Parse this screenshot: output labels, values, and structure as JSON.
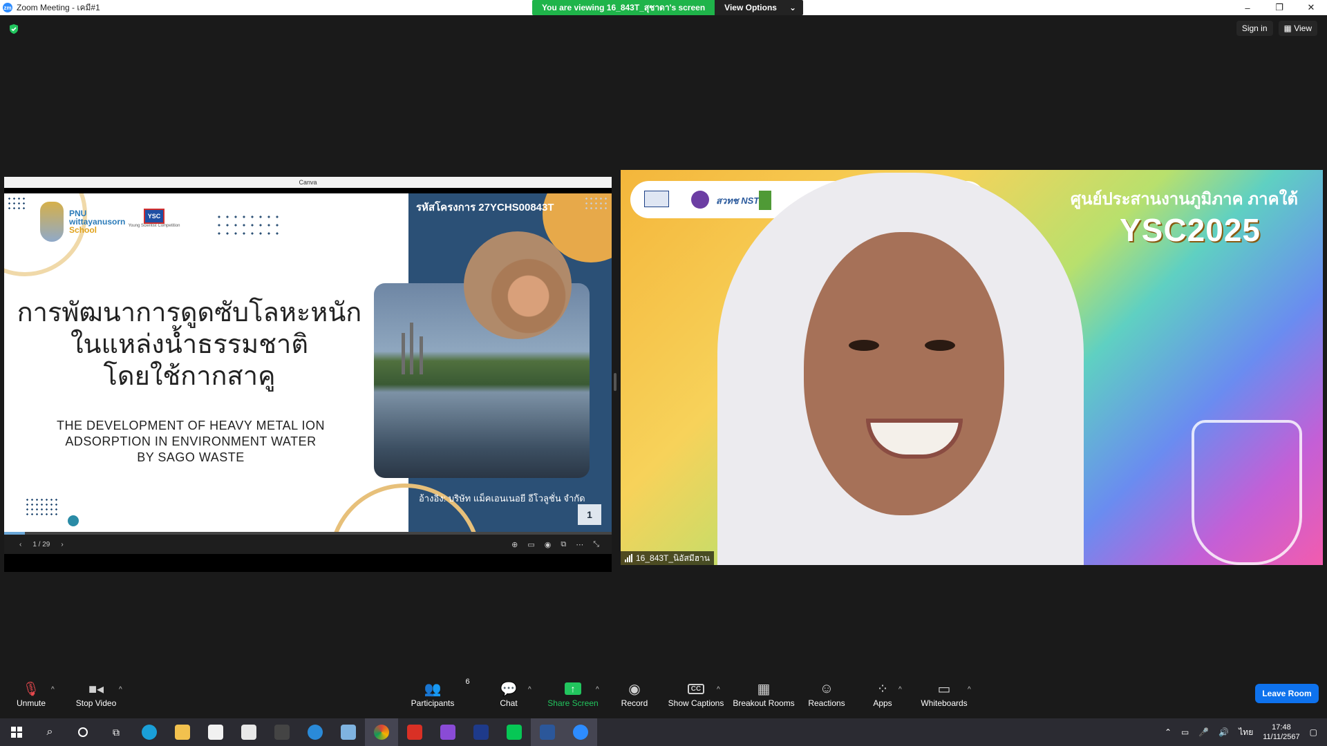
{
  "window": {
    "title": "Zoom Meeting - เคมี#1",
    "viewing_text": "You are viewing 16_843T_สุชาดา's screen",
    "view_options": "View Options",
    "minimize": "–",
    "restore": "❐",
    "close": "✕"
  },
  "meeting_header": {
    "sign_in": "Sign in",
    "view": "View"
  },
  "shared_screen": {
    "canva_label": "Canva",
    "project_code": "รหัสโครงการ 27YCHS00843T",
    "school_line1": "PNU",
    "school_line2": "wittayanusorn",
    "school_line3": "School",
    "ysc_badge": "YSC",
    "ysc_caption": "Young Scientist Competition",
    "thai_title_1": "การพัฒนาการดูดซับโลหะหนัก",
    "thai_title_2": "ในแหล่งน้ำธรรมชาติ",
    "thai_title_3": "โดยใช้กากสาคู",
    "eng_title_1": "THE DEVELOPMENT OF HEAVY METAL ION",
    "eng_title_2": "ADSORPTION IN ENVIRONMENT WATER",
    "eng_title_3": "BY SAGO WASTE",
    "credit": "อ้างอิง: บริษัท แม็คเอนเนอยี อีโวลูชั่น จำกัด",
    "page_number": "1",
    "page_indicator": "1 / 29",
    "progress": 0.034
  },
  "video": {
    "banner_logo_text": "สวทช NSTDA",
    "region_text": "ศูนย์ประสานงานภูมิภาค ภาคใต้",
    "ysc_text": "YSC2025",
    "participant_name": "16_843T_นิอัสมีฮาน"
  },
  "toolbar": {
    "unmute": "Unmute",
    "stop_video": "Stop Video",
    "participants": "Participants",
    "participants_count": "6",
    "chat": "Chat",
    "share_screen": "Share Screen",
    "record": "Record",
    "show_captions": "Show Captions",
    "breakout_rooms": "Breakout Rooms",
    "reactions": "Reactions",
    "apps": "Apps",
    "whiteboards": "Whiteboards",
    "leave_room": "Leave Room"
  },
  "taskbar": {
    "language": "ไทย",
    "time": "17:48",
    "date": "11/11/2567"
  },
  "colors": {
    "share_green": "#22c55e",
    "leave_blue": "#0e72ed",
    "slide_navy": "#2b5076",
    "slide_gold": "#e7a94a"
  }
}
